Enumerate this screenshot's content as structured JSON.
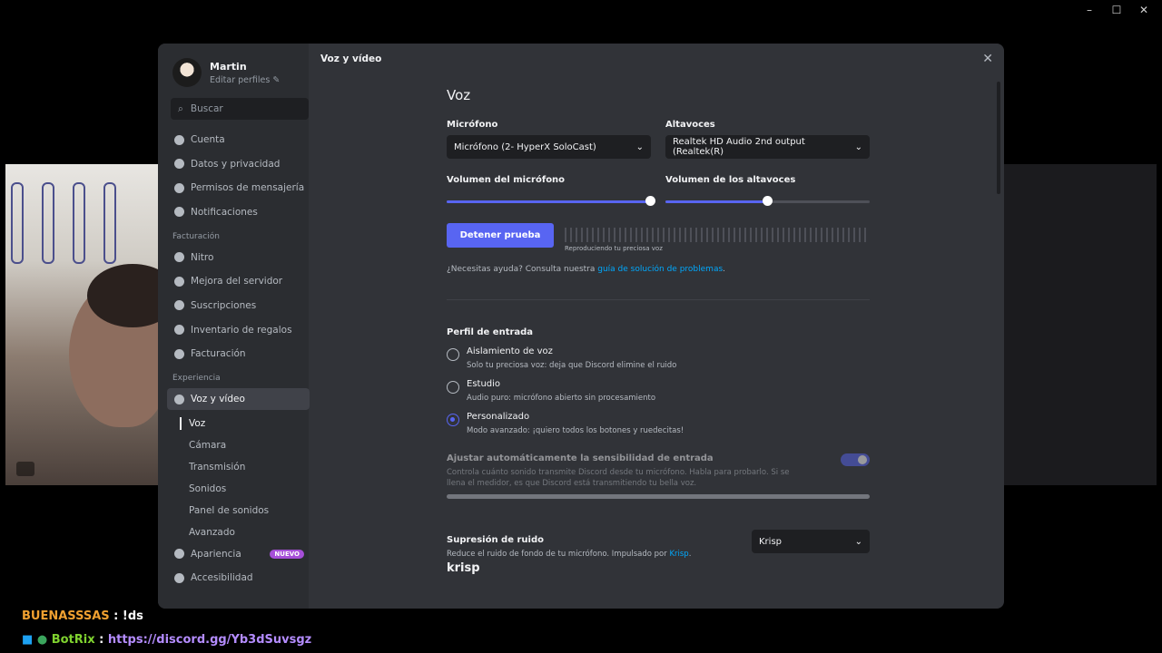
{
  "window": {
    "minimize": "–",
    "maximize": "☐",
    "close": "✕"
  },
  "profile": {
    "name": "Martin",
    "edit": "Editar perfiles"
  },
  "search": {
    "placeholder": "Buscar"
  },
  "nav": {
    "user": [
      "Cuenta",
      "Datos y privacidad",
      "Permisos de mensajería",
      "Notificaciones"
    ],
    "billing_title": "Facturación",
    "billing": [
      "Nitro",
      "Mejora del servidor",
      "Suscripciones",
      "Inventario de regalos",
      "Facturación"
    ],
    "experience_title": "Experiencia",
    "voice": "Voz y vídeo",
    "subs": [
      "Voz",
      "Cámara",
      "Transmisión",
      "Sonidos",
      "Panel de sonidos",
      "Avanzado"
    ],
    "appearance": "Apariencia",
    "new_badge": "NUEVO",
    "accessibility": "Accesibilidad"
  },
  "header": "Voz y vídeo",
  "content": {
    "title": "Voz",
    "mic_label": "Micrófono",
    "mic_value": "Micrófono (2- HyperX SoloCast)",
    "spk_label": "Altavoces",
    "spk_value": "Realtek HD Audio 2nd output (Realtek(R)",
    "mic_vol_label": "Volumen del micrófono",
    "mic_vol": 1.0,
    "spk_vol_label": "Volumen de los altavoces",
    "spk_vol": 0.5,
    "test_button": "Detener prueba",
    "meter_caption": "Reproduciendo tu preciosa voz",
    "help_prefix": "¿Necesitas ayuda? Consulta nuestra ",
    "help_link": "guía de solución de problemas",
    "help_suffix": ".",
    "profile_title": "Perfil de entrada",
    "profiles": [
      {
        "title": "Aislamiento de voz",
        "desc": "Solo tu preciosa voz: deja que Discord elimine el ruido"
      },
      {
        "title": "Estudio",
        "desc": "Audio puro: micrófono abierto sin procesamiento"
      },
      {
        "title": "Personalizado",
        "desc": "Modo avanzado: ¡quiero todos los botones y ruedecitas!"
      }
    ],
    "selected_profile": 2,
    "auto_title": "Ajustar automáticamente la sensibilidad de entrada",
    "auto_desc": "Controla cuánto sonido transmite Discord desde tu micrófono. Habla para probarlo. Si se llena el medidor, es que Discord está transmitiendo tu bella voz.",
    "noise_title": "Supresión de ruido",
    "noise_desc_prefix": "Reduce el ruido de fondo de tu micrófono. Impulsado por ",
    "noise_link": "Krisp",
    "noise_desc_suffix": ".",
    "krisp_logo": "krisp",
    "noise_value": "Krisp"
  },
  "chat": [
    {
      "user": "BUENASSSAS",
      "sep": " : ",
      "msg": "!ds",
      "color": "#f0a030"
    },
    {
      "user": "BotRix",
      "sep": " : ",
      "msg": "https://discord.gg/Yb3dSuvsgz",
      "color": "#7fd22f",
      "link_color": "#b48cff"
    }
  ],
  "colors": {
    "accent": "#5865f2",
    "link": "#00a8fc"
  }
}
